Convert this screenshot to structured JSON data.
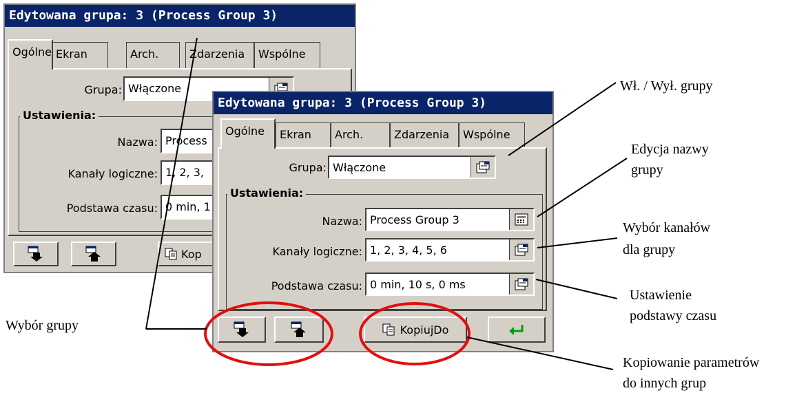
{
  "window": {
    "title": "Edytowana grupa: 3 (Process Group 3)",
    "tabs": [
      {
        "label": "Ogólne",
        "active": true
      },
      {
        "label": "Ekran",
        "active": false
      },
      {
        "label": "Arch.",
        "active": false
      },
      {
        "label": "Zdarzenia",
        "active": false
      },
      {
        "label": "Wspólne",
        "active": false
      }
    ],
    "grupa": {
      "label": "Grupa:",
      "value": "Włączone"
    },
    "settings": {
      "title": "Ustawienia:",
      "nazwa": {
        "label": "Nazwa:",
        "value": "Process Group 3"
      },
      "kanaly": {
        "label": "Kanały logiczne:",
        "value": "1, 2, 3, 4, 5, 6"
      },
      "czas": {
        "label": "Podstawa czasu:",
        "value": "0 min, 10 s, 0 ms"
      }
    },
    "back_window": {
      "nazwa_value": "Process",
      "kanaly_value": "1, 2, 3,",
      "czas_value": "0 min, 1",
      "copy_label": "Kop"
    },
    "toolbar": {
      "copy_label": "KopiujDo"
    }
  },
  "annotations": {
    "grupa_toggle": "Wł. / Wył. grupy",
    "edit_name_1": "Edycja nazwy",
    "edit_name_2": "grupy",
    "channels_1": "Wybór kanałów",
    "channels_2": "dla grupy",
    "timebase_1": "Ustawienie",
    "timebase_2": "podstawy czasu",
    "group_select": "Wybór grupy",
    "copy_1": "Kopiowanie parametrów",
    "copy_2": "do innych grup"
  },
  "colors": {
    "titlebar": "#0a246a",
    "face": "#d4d0c8",
    "highlight": "#e01010",
    "accept_arrow": "#00a000"
  }
}
